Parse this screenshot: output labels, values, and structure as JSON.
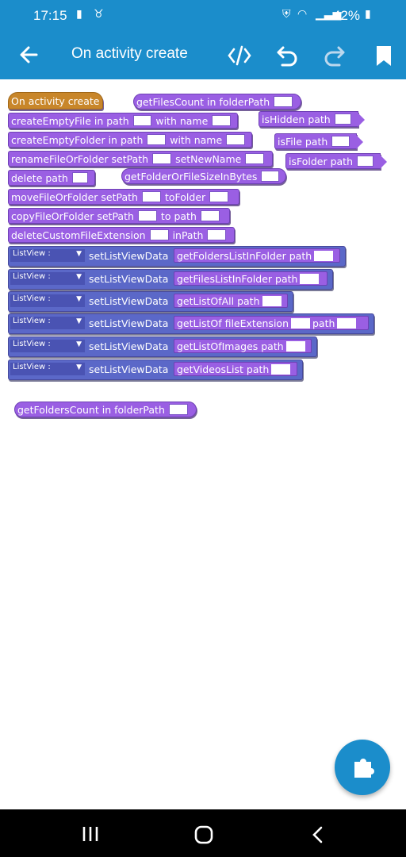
{
  "status": {
    "time": "17:15",
    "battery_percent": "42%"
  },
  "appbar": {
    "title": "On activity create"
  },
  "blocks": {
    "event": "On activity create",
    "getFilesCount": {
      "label": "getFilesCount  in folderPath"
    },
    "createEmptyFile": {
      "a": "createEmptyFile  in path",
      "b": "with  name"
    },
    "isHidden": "isHidden  path",
    "createEmptyFolder": {
      "a": "createEmptyFolder  in path",
      "b": "with  name"
    },
    "isFile": "isFile  path",
    "renameFileOrFolder": {
      "a": "renameFileOrFolder  setPath",
      "b": "setNewName"
    },
    "isFolder": "isFolder  path",
    "deletePath": "delete  path",
    "getFolderOrFileSize": "getFolderOrFileSizeInBytes",
    "moveFileOrFolder": {
      "a": "moveFileOrFolder  setPath",
      "b": "toFolder"
    },
    "copyFileOrFolder": {
      "a": "copyFileOrFolder  setPath",
      "b": "to  path"
    },
    "deleteCustomFileExtension": {
      "a": "deleteCustomFileExtension",
      "b": "inPath"
    },
    "getFoldersCount": "getFoldersCount  in folderPath"
  },
  "list_rows": [
    {
      "dropdown": "ListView :",
      "action": "setListViewData",
      "inner": "getFoldersListInFolder  path"
    },
    {
      "dropdown": "ListView :",
      "action": "setListViewData",
      "inner": "getFilesListInFolder  path"
    },
    {
      "dropdown": "ListView :",
      "action": "setListViewData",
      "inner": "getListOfAll  path"
    },
    {
      "dropdown": "ListView :",
      "action": "setListViewData",
      "inner": "getListOf  fileExtension",
      "inner2": "path"
    },
    {
      "dropdown": "ListView :",
      "action": "setListViewData",
      "inner": "getListOfImages  path"
    },
    {
      "dropdown": "ListView :",
      "action": "setListViewData",
      "inner": "getVideosList  path"
    }
  ],
  "colors": {
    "accent": "#1b8dcb",
    "block_purple": "#9a5fe3",
    "block_blue": "#5b68c8",
    "event_orange": "#c8862a"
  },
  "icons": [
    "back-arrow-icon",
    "code-icon",
    "undo-icon",
    "redo-icon",
    "bookmark-icon",
    "puzzle-icon"
  ]
}
